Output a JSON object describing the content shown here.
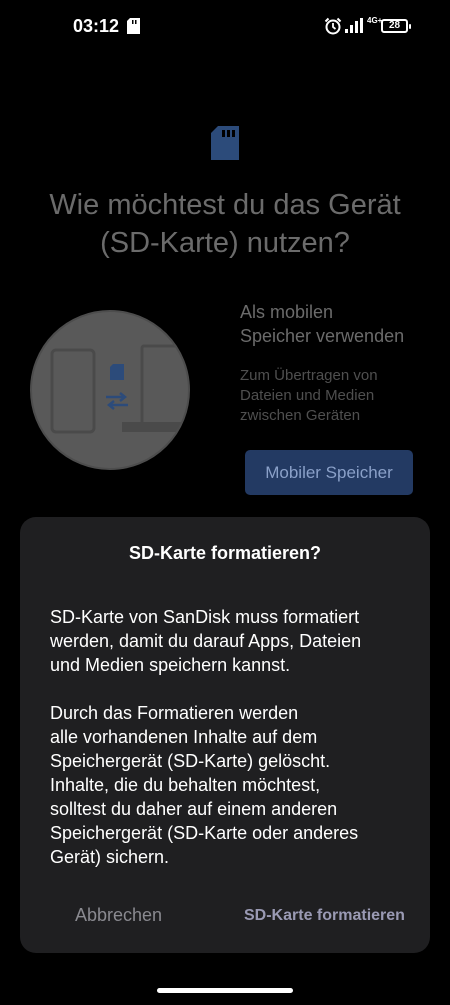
{
  "status_bar": {
    "time": "03:12",
    "network": "4G+",
    "battery": "28"
  },
  "background": {
    "title_line1": "Wie möchtest du das Gerät",
    "title_line2": "(SD-Karte) nutzen?",
    "option_title_line1": "Als mobilen",
    "option_title_line2": "Speicher verwenden",
    "option_desc_line1": "Zum Übertragen von",
    "option_desc_line2": "Dateien und Medien",
    "option_desc_line3": "zwischen Geräten",
    "mobile_button": "Mobiler Speicher"
  },
  "dialog": {
    "title": "SD-Karte formatieren?",
    "paragraph1_line1": "SD-Karte von SanDisk muss formatiert",
    "paragraph1_line2": "werden, damit du darauf Apps, Dateien",
    "paragraph1_line3": "und Medien speichern kannst.",
    "paragraph2_line1": "Durch das Formatieren werden",
    "paragraph2_line2": "alle vorhandenen Inhalte auf dem",
    "paragraph2_line3": "Speichergerät (SD-Karte) gelöscht.",
    "paragraph2_line4": "Inhalte, die du behalten möchtest,",
    "paragraph2_line5": "solltest du daher auf einem anderen",
    "paragraph2_line6": "Speichergerät (SD-Karte oder anderes",
    "paragraph2_line7": "Gerät) sichern.",
    "cancel_button": "Abbrechen",
    "format_button": "SD-Karte formatieren"
  },
  "colors": {
    "dialog_bg": "#1f1f21",
    "accent_button": "#233a63",
    "sd_icon": "#2c4b7a"
  }
}
